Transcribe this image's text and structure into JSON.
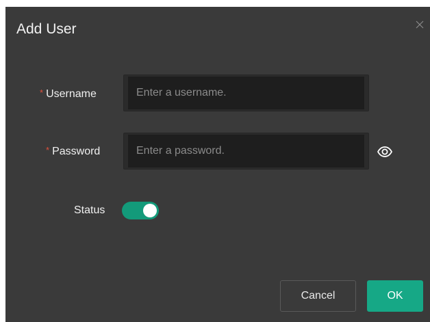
{
  "dialog": {
    "title": "Add User"
  },
  "form": {
    "username": {
      "required_mark": "*",
      "label": "Username",
      "value": "",
      "placeholder": "Enter a username."
    },
    "password": {
      "required_mark": "*",
      "label": "Password",
      "value": "",
      "placeholder": "Enter a password.",
      "visibility_icon": "eye-icon"
    },
    "status": {
      "label": "Status",
      "enabled": true
    }
  },
  "footer": {
    "cancel_label": "Cancel",
    "ok_label": "OK"
  },
  "colors": {
    "dialog_bg": "#3a3a3a",
    "input_bg": "#1e1e1e",
    "accent": "#16a886",
    "required": "#e0503c"
  },
  "icons": {
    "close": "close-icon",
    "eye": "eye-icon"
  }
}
